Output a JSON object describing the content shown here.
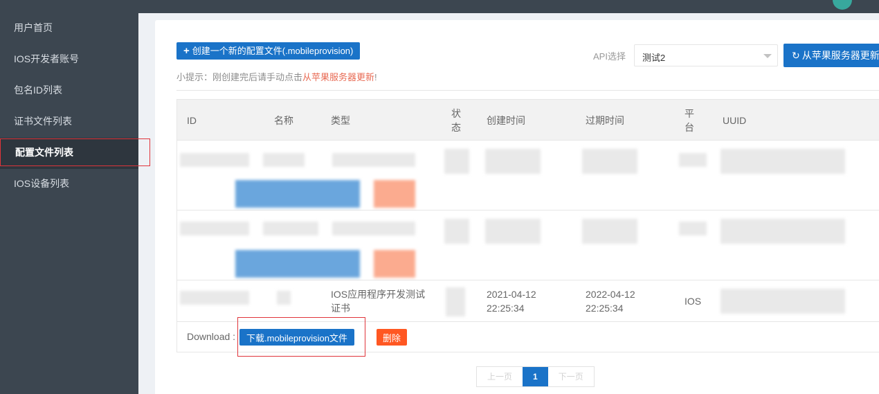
{
  "sidebar": {
    "items": [
      {
        "label": "用户首页"
      },
      {
        "label": "IOS开发者账号"
      },
      {
        "label": "包名ID列表"
      },
      {
        "label": "证书文件列表"
      },
      {
        "label": "配置文件列表"
      },
      {
        "label": "IOS设备列表"
      }
    ]
  },
  "toolbar": {
    "create_label": "创建一个新的配置文件(.mobileprovision)",
    "api_label": "API选择",
    "api_selected": "测试2",
    "sync_label": "从苹果服务器更新"
  },
  "tip": {
    "prefix": "小提示：刚创建完后请手动点击",
    "highlight": "从苹果服务器更新",
    "suffix": "!"
  },
  "table": {
    "headers": [
      "ID",
      "名称",
      "类型",
      "状态",
      "创建时间",
      "过期时间",
      "平台",
      "UUID"
    ],
    "row": {
      "type": "IOS应用程序开发测试证书",
      "created": "2021-04-12 22:25:34",
      "expires": "2022-04-12 22:25:34",
      "platform": "IOS"
    },
    "download_label": "Download :",
    "download_button": "下载.mobileprovision文件",
    "delete_button": "删除"
  },
  "pagination": {
    "prev": "上一页",
    "current": "1",
    "next": "下一页"
  },
  "colors": {
    "sidebar_bg": "#3c4650",
    "primary": "#1a73c8",
    "danger": "#ff5722",
    "highlight_text": "#e86a53"
  }
}
